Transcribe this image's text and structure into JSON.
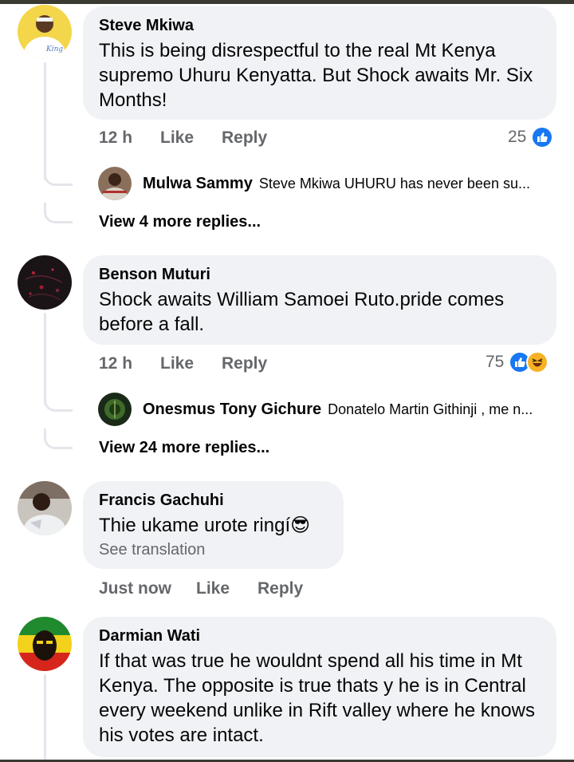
{
  "comments": [
    {
      "author": "Steve Mkiwa",
      "text": "This is being disrespectful to the real Mt Kenya supremo Uhuru Kenyatta. But Shock awaits Mr. Six Months!",
      "time": "12 h",
      "like_label": "Like",
      "reply_label": "Reply",
      "reaction_count": "25",
      "reply_preview": {
        "author": "Mulwa Sammy",
        "text": "Steve Mkiwa UHURU has never been su..."
      },
      "view_more": "View 4 more replies..."
    },
    {
      "author": "Benson Muturi",
      "text": "Shock awaits William Samoei Ruto.pride comes before a fall.",
      "time": "12 h",
      "like_label": "Like",
      "reply_label": "Reply",
      "reaction_count": "75",
      "reply_preview": {
        "author": "Onesmus Tony Gichure",
        "text": "Donatelo Martin Githinji , me n..."
      },
      "view_more": "View 24 more replies..."
    },
    {
      "author": "Francis Gachuhi",
      "text": "Thie ukame urote ringí😎",
      "translation": "See translation",
      "time": "Just now",
      "like_label": "Like",
      "reply_label": "Reply"
    },
    {
      "author": "Darmian Wati",
      "text": "If that was true he wouldnt spend all his time in Mt Kenya. The opposite is true thats y he is in Central every weekend unlike in Rift valley where he knows his votes are intact."
    }
  ],
  "colors": {
    "bubble": "#f0f2f5",
    "secondary_text": "#65676b",
    "like_blue": "#1877f2",
    "haha_yellow": "#f7b125",
    "thread_line": "#e4e6eb"
  }
}
